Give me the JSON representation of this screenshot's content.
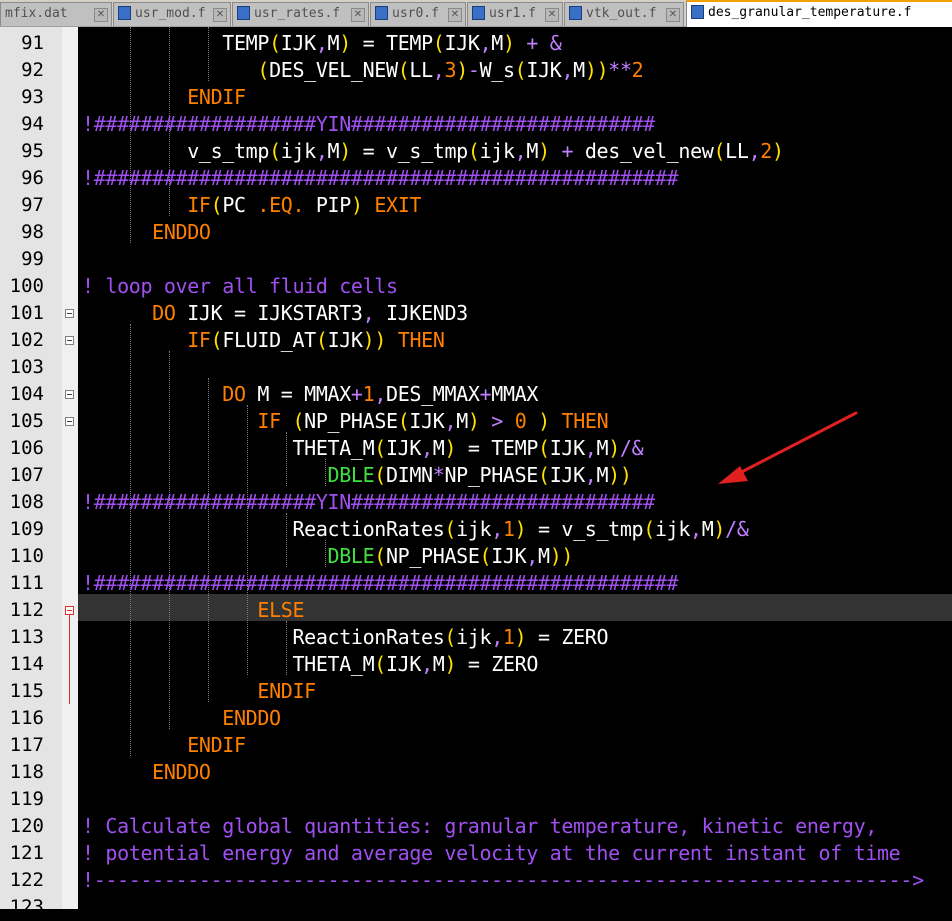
{
  "tabs": [
    {
      "label": "mfix.dat",
      "active": false
    },
    {
      "label": "usr_mod.f",
      "active": false
    },
    {
      "label": "usr_rates.f",
      "active": false
    },
    {
      "label": "usr0.f",
      "active": false
    },
    {
      "label": "usr1.f",
      "active": false
    },
    {
      "label": "vtk_out.f",
      "active": false
    },
    {
      "label": "des_granular_temperature.f",
      "active": true
    }
  ],
  "editor": {
    "current_line": 112,
    "annotation": "red-arrow pointing at line 107",
    "lines": [
      {
        "n": "91",
        "text": "            TEMP(IJK,M) = TEMP(IJK,M) + &"
      },
      {
        "n": "92",
        "text": "               (DES_VEL_NEW(LL,3)-W_s(IJK,M))**2"
      },
      {
        "n": "93",
        "text": "         ENDIF"
      },
      {
        "n": "94",
        "text": "!###################YIN##########################"
      },
      {
        "n": "95",
        "text": "         v_s_tmp(ijk,M) = v_s_tmp(ijk,M) + des_vel_new(LL,2)"
      },
      {
        "n": "96",
        "text": "!##################################################"
      },
      {
        "n": "97",
        "text": "         IF(PC .EQ. PIP) EXIT"
      },
      {
        "n": "98",
        "text": "      ENDDO"
      },
      {
        "n": "99",
        "text": ""
      },
      {
        "n": "100",
        "text": "! loop over all fluid cells"
      },
      {
        "n": "101",
        "text": "      DO IJK = IJKSTART3, IJKEND3"
      },
      {
        "n": "102",
        "text": "         IF(FLUID_AT(IJK)) THEN"
      },
      {
        "n": "103",
        "text": ""
      },
      {
        "n": "104",
        "text": "            DO M = MMAX+1,DES_MMAX+MMAX"
      },
      {
        "n": "105",
        "text": "               IF (NP_PHASE(IJK,M) > 0 ) THEN"
      },
      {
        "n": "106",
        "text": "                  THETA_M(IJK,M) = TEMP(IJK,M)/&"
      },
      {
        "n": "107",
        "text": "                     DBLE(DIMN*NP_PHASE(IJK,M))"
      },
      {
        "n": "108",
        "text": "!###################YIN##########################"
      },
      {
        "n": "109",
        "text": "                  ReactionRates(ijk,1) = v_s_tmp(ijk,M)/&"
      },
      {
        "n": "110",
        "text": "                     DBLE(NP_PHASE(IJK,M))"
      },
      {
        "n": "111",
        "text": "!##################################################"
      },
      {
        "n": "112",
        "text": "               ELSE"
      },
      {
        "n": "113",
        "text": "                  ReactionRates(ijk,1) = ZERO"
      },
      {
        "n": "114",
        "text": "                  THETA_M(IJK,M) = ZERO"
      },
      {
        "n": "115",
        "text": "               ENDIF"
      },
      {
        "n": "116",
        "text": "            ENDDO"
      },
      {
        "n": "117",
        "text": "         ENDIF"
      },
      {
        "n": "118",
        "text": "      ENDDO"
      },
      {
        "n": "119",
        "text": ""
      },
      {
        "n": "120",
        "text": "! Calculate global quantities: granular temperature, kinetic energy,"
      },
      {
        "n": "121",
        "text": "! potential energy and average velocity at the current instant of time"
      },
      {
        "n": "122",
        "text": "!---------------------------------------------------------------------->"
      },
      {
        "n": "123",
        "text": ""
      }
    ]
  },
  "colors": {
    "keyword": "#ff8000",
    "number": "#ff8000",
    "operator": "#c080ff",
    "comment": "#a050f0",
    "builtin": "#40e040",
    "text": "#ffffff",
    "arrow": "#e02020"
  }
}
